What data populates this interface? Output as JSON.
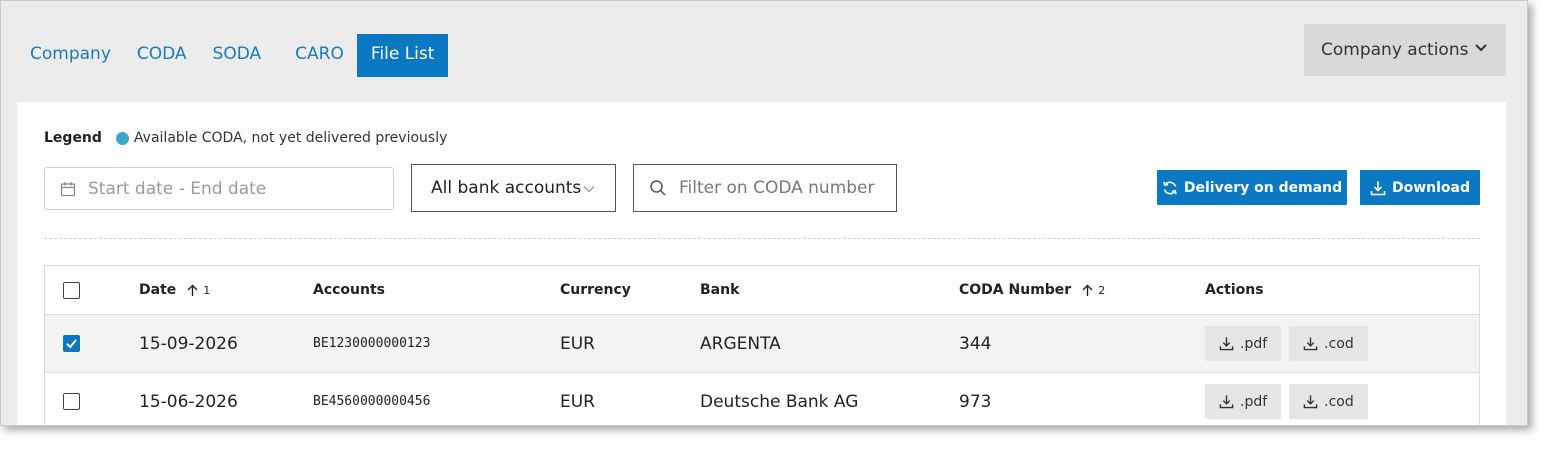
{
  "tabs": [
    {
      "label": "Company"
    },
    {
      "label": "CODA"
    },
    {
      "label": "SODA"
    },
    {
      "label": "CARO"
    },
    {
      "label": "File List",
      "active": true
    }
  ],
  "company_actions_label": "Company actions",
  "legend": {
    "title": "Legend",
    "text": "Available CODA, not yet delivered previously",
    "dot_color": "#3aa7cf"
  },
  "filters": {
    "date_placeholder": "Start date - End date",
    "bank_accounts_selected": "All bank accounts",
    "coda_placeholder": "Filter on CODA number"
  },
  "buttons": {
    "delivery_on_demand": "Delivery on demand",
    "download": "Download"
  },
  "table": {
    "headers": {
      "date": "Date",
      "date_sort_order": "1",
      "accounts": "Accounts",
      "currency": "Currency",
      "bank": "Bank",
      "coda_number": "CODA Number",
      "coda_sort_order": "2",
      "actions": "Actions"
    },
    "rows": [
      {
        "checked": true,
        "date": "15-09-2026",
        "account": "BE1230000000123",
        "currency": "EUR",
        "bank": "ARGENTA",
        "coda_number": "344",
        "pdf_label": ".pdf",
        "cod_label": ".cod"
      },
      {
        "checked": false,
        "date": "15-06-2026",
        "account": "BE4560000000456",
        "currency": "EUR",
        "bank": "Deutsche Bank AG",
        "coda_number": "973",
        "pdf_label": ".pdf",
        "cod_label": ".cod"
      }
    ]
  },
  "colors": {
    "accent": "#0a78c2",
    "tab_text": "#1a7abf"
  }
}
